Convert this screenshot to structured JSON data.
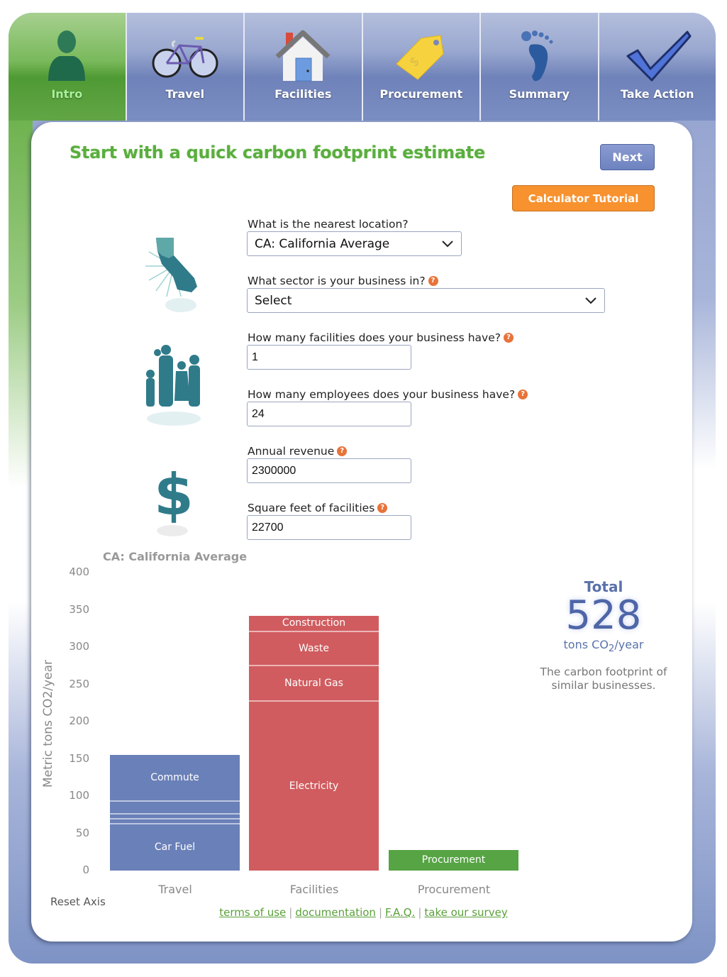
{
  "nav": {
    "tabs": [
      {
        "label": "Intro",
        "icon": "person-silhouette-icon",
        "active": true
      },
      {
        "label": "Travel",
        "icon": "bicycle-icon",
        "active": false
      },
      {
        "label": "Facilities",
        "icon": "house-icon",
        "active": false
      },
      {
        "label": "Procurement",
        "icon": "price-tag-icon",
        "active": false
      },
      {
        "label": "Summary",
        "icon": "footprint-icon",
        "active": false
      },
      {
        "label": "Take Action",
        "icon": "checkmark-icon",
        "active": false
      }
    ]
  },
  "page": {
    "title": "Start with a quick carbon footprint estimate",
    "next_label": "Next",
    "tutorial_label": "Calculator Tutorial",
    "help_glyph": "?"
  },
  "form": {
    "location": {
      "label": "What is the nearest location?",
      "value": "CA: California Average"
    },
    "sector": {
      "label": "What sector is your business in?",
      "value": "Select"
    },
    "facilities": {
      "label": "How many facilities does your business have?",
      "value": "1"
    },
    "employees": {
      "label": "How many employees does your business have?",
      "value": "24"
    },
    "revenue": {
      "label": "Annual revenue",
      "value": "2300000"
    },
    "sqft": {
      "label": "Square feet of facilities",
      "value": "22700"
    }
  },
  "total": {
    "label": "Total",
    "value": "528",
    "units_prefix": "tons CO",
    "units_sub": "2",
    "units_suffix": "/year",
    "description": "The carbon footprint of similar businesses."
  },
  "reset_axis_label": "Reset Axis",
  "footer": {
    "links": [
      "terms of use",
      "documentation",
      "F.A.Q.",
      "take our survey"
    ]
  },
  "colors": {
    "travel": "#6a80b8",
    "facilities": "#d05c5f",
    "procurement": "#56a444",
    "accent_green": "#5aae3f",
    "tutorial_orange": "#f7922f"
  },
  "chart_data": {
    "type": "bar",
    "stacked": true,
    "title": "CA: California Average",
    "xlabel": "",
    "ylabel": "Metric tons CO2/year",
    "ylim": [
      0,
      400
    ],
    "yticks": [
      0,
      50,
      100,
      150,
      200,
      250,
      300,
      350,
      400
    ],
    "grid": false,
    "categories": [
      "Travel",
      "Facilities",
      "Procurement"
    ],
    "bars": [
      {
        "category": "Travel",
        "color": "#6a80b8",
        "segments": [
          {
            "name": "Car Fuel",
            "value": 62,
            "label": "Car Fuel"
          },
          {
            "name": "Segment 2",
            "value": 7,
            "label": ""
          },
          {
            "name": "Segment 3",
            "value": 6,
            "label": ""
          },
          {
            "name": "Segment 4",
            "value": 17,
            "label": ""
          },
          {
            "name": "Commute",
            "value": 63,
            "label": "Commute"
          }
        ]
      },
      {
        "category": "Facilities",
        "color": "#d05c5f",
        "segments": [
          {
            "name": "Electricity",
            "value": 227,
            "label": "Electricity"
          },
          {
            "name": "Natural Gas",
            "value": 47,
            "label": "Natural Gas"
          },
          {
            "name": "Waste",
            "value": 46,
            "label": "Waste"
          },
          {
            "name": "Construction",
            "value": 22,
            "label": "Construction"
          }
        ]
      },
      {
        "category": "Procurement",
        "color": "#56a444",
        "segments": [
          {
            "name": "Procurement",
            "value": 28,
            "label": "Procurement"
          }
        ]
      }
    ]
  }
}
